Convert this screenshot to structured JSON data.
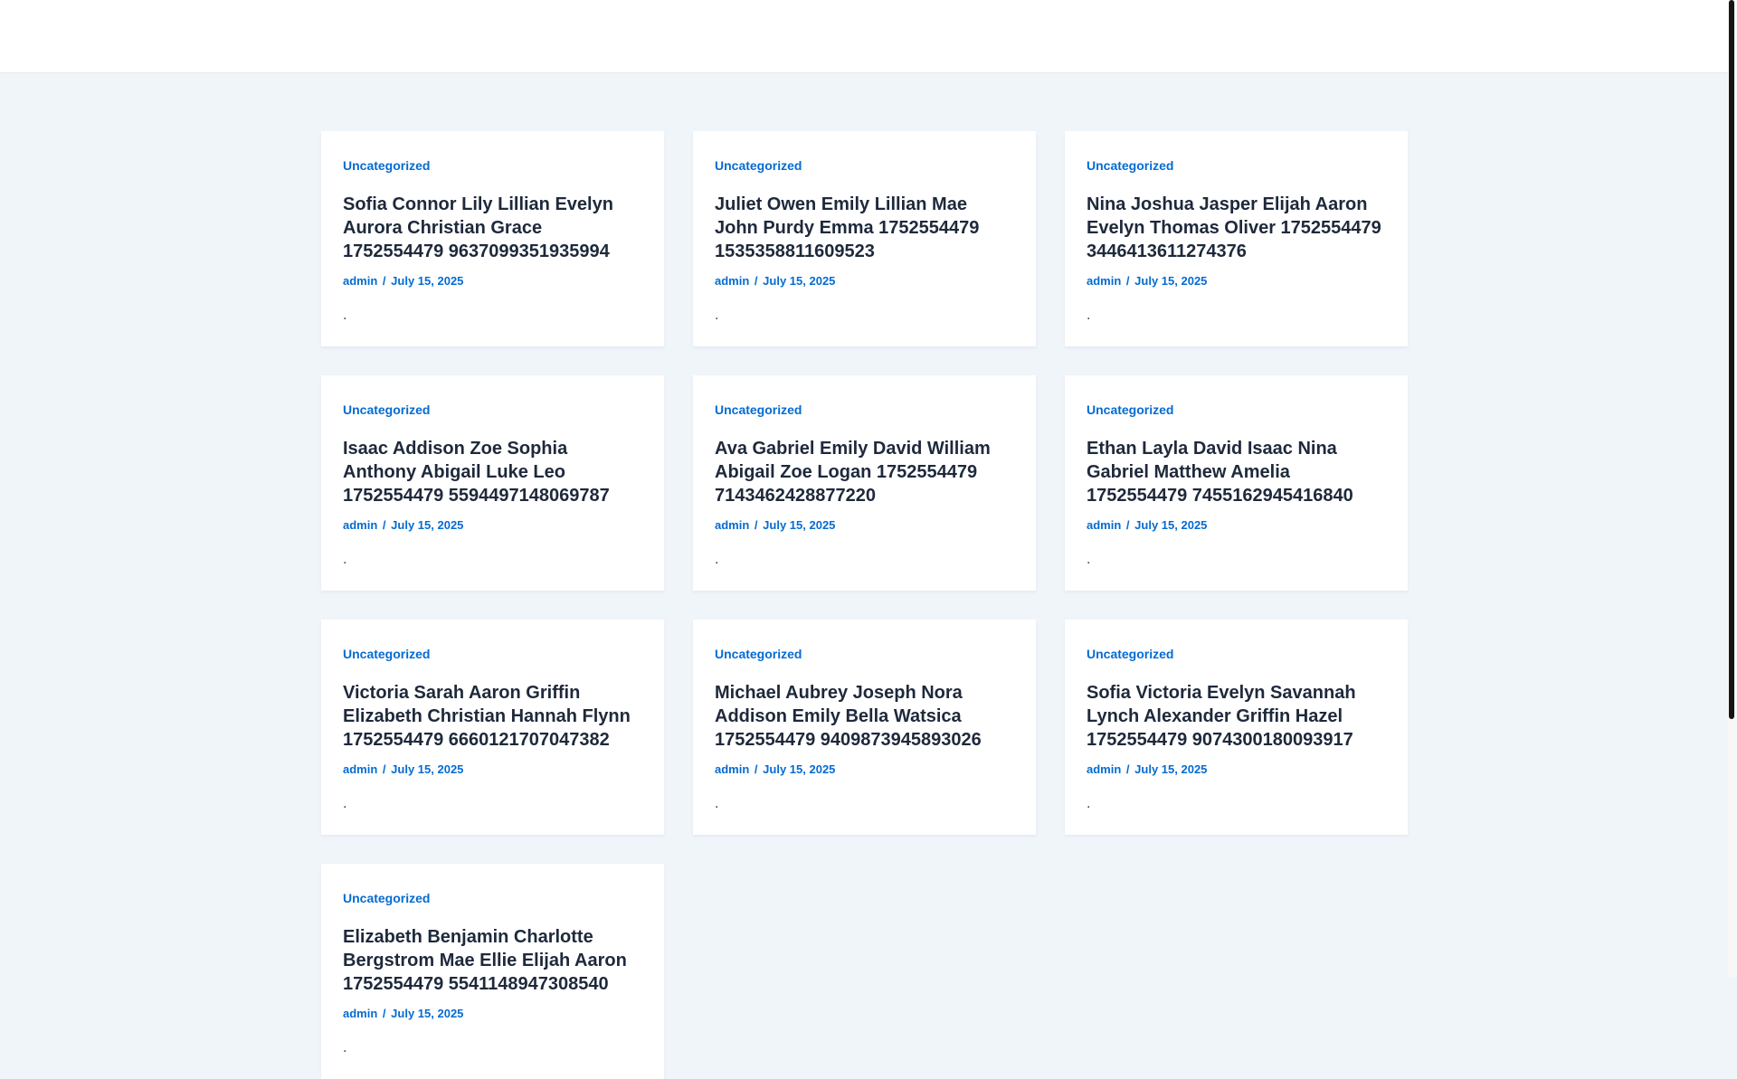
{
  "posts": [
    {
      "category": "Uncategorized",
      "title": "Sofia Connor Lily Lillian Evelyn Aurora Christian Grace 1752554479 9637099351935994",
      "author": "admin",
      "separator": "/",
      "date": "July 15, 2025",
      "excerpt": "."
    },
    {
      "category": "Uncategorized",
      "title": "Juliet Owen Emily Lillian Mae John Purdy Emma 1752554479 1535358811609523",
      "author": "admin",
      "separator": "/",
      "date": "July 15, 2025",
      "excerpt": "."
    },
    {
      "category": "Uncategorized",
      "title": "Nina Joshua Jasper Elijah Aaron Evelyn Thomas Oliver 1752554479 3446413611274376",
      "author": "admin",
      "separator": "/",
      "date": "July 15, 2025",
      "excerpt": "."
    },
    {
      "category": "Uncategorized",
      "title": "Isaac Addison Zoe Sophia Anthony Abigail Luke Leo 1752554479 5594497148069787",
      "author": "admin",
      "separator": "/",
      "date": "July 15, 2025",
      "excerpt": "."
    },
    {
      "category": "Uncategorized",
      "title": "Ava Gabriel Emily David William Abigail Zoe Logan 1752554479 7143462428877220",
      "author": "admin",
      "separator": "/",
      "date": "July 15, 2025",
      "excerpt": "."
    },
    {
      "category": "Uncategorized",
      "title": "Ethan Layla David Isaac Nina Gabriel Matthew Amelia 1752554479 7455162945416840",
      "author": "admin",
      "separator": "/",
      "date": "July 15, 2025",
      "excerpt": "."
    },
    {
      "category": "Uncategorized",
      "title": "Victoria Sarah Aaron Griffin Elizabeth Christian Hannah Flynn 1752554479 6660121707047382",
      "author": "admin",
      "separator": "/",
      "date": "July 15, 2025",
      "excerpt": "."
    },
    {
      "category": "Uncategorized",
      "title": "Michael Aubrey Joseph Nora Addison Emily Bella Watsica 1752554479 9409873945893026",
      "author": "admin",
      "separator": "/",
      "date": "July 15, 2025",
      "excerpt": "."
    },
    {
      "category": "Uncategorized",
      "title": "Sofia Victoria Evelyn Savannah Lynch Alexander Griffin Hazel 1752554479 9074300180093917",
      "author": "admin",
      "separator": "/",
      "date": "July 15, 2025",
      "excerpt": "."
    },
    {
      "category": "Uncategorized",
      "title": "Elizabeth Benjamin Charlotte Bergstrom Mae Ellie Elijah Aaron 1752554479 5541148947308540",
      "author": "admin",
      "separator": "/",
      "date": "July 15, 2025",
      "excerpt": "."
    }
  ],
  "colors": {
    "accent": "#046bd2",
    "heading": "#1e293b",
    "background": "#f0f5fa",
    "card": "#ffffff"
  }
}
